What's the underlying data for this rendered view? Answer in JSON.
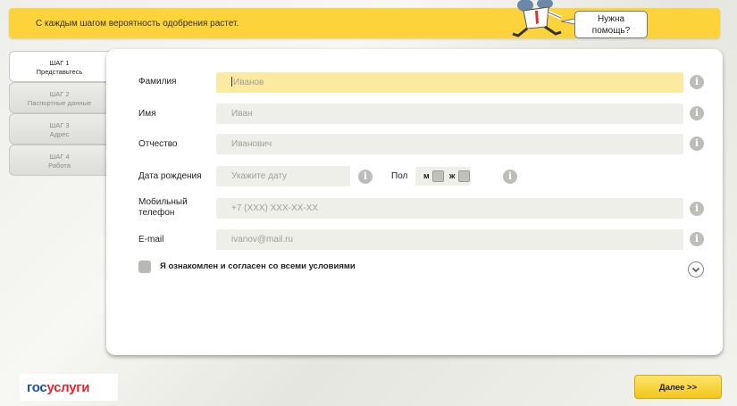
{
  "banner": {
    "text": "С каждым шагом вероятность одобрения растет."
  },
  "help": {
    "line1": "Нужна",
    "line2": "помощь?"
  },
  "steps": [
    {
      "title": "ШАГ 1",
      "subtitle": "Представьтесь"
    },
    {
      "title": "ШАГ 2",
      "subtitle": "Паспортные данные"
    },
    {
      "title": "ШАГ 3",
      "subtitle": "Адрес"
    },
    {
      "title": "ШАГ 4",
      "subtitle": "Работа"
    }
  ],
  "form": {
    "surname": {
      "label": "Фамилия",
      "placeholder": "Иванов"
    },
    "name": {
      "label": "Имя",
      "placeholder": "Иван"
    },
    "patronymic": {
      "label": "Отчество",
      "placeholder": "Иванович"
    },
    "birthdate": {
      "label": "Дата рождения",
      "placeholder": "Укажите дату"
    },
    "gender": {
      "label": "Пол",
      "male": "м",
      "female": "ж"
    },
    "phone": {
      "label1": "Мобильный",
      "label2": "телефон",
      "placeholder": "+7 (XXX) XXX-XX-XX"
    },
    "email": {
      "label": "E-mail",
      "placeholder": "ivanov@mail.ru"
    },
    "agree": {
      "label": "Я ознакомлен и согласен со всеми условиями"
    }
  },
  "footer": {
    "logo_part1": "гос",
    "logo_part2": "услуги",
    "next_label": "Далее >>"
  },
  "colors": {
    "accent": "#fdd33b",
    "highlight_field": "#fdeaa1",
    "logo_blue": "#1d4fa0",
    "logo_red": "#e0262e"
  },
  "icons": {
    "info": "info-icon",
    "chevron": "chevron-down-icon"
  }
}
